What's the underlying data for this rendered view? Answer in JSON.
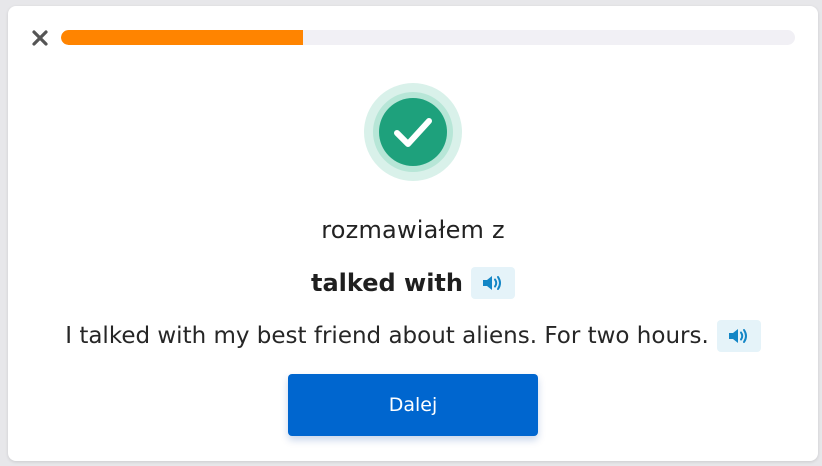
{
  "progress": {
    "value_percent": 33,
    "fill_color": "#ff8400",
    "track_color": "#f1f0f5"
  },
  "icons": {
    "close": "close-icon",
    "success": "checkmark-icon",
    "audio": "speaker-icon"
  },
  "feedback": {
    "prompt": "rozmawiałem z",
    "answer": "talked with",
    "sentence": "I talked with my best friend about aliens. For two hours."
  },
  "actions": {
    "next_label": "Dalej"
  },
  "colors": {
    "success": "#1ea17c",
    "primary": "#0066cf",
    "audio": "#1386c6"
  }
}
